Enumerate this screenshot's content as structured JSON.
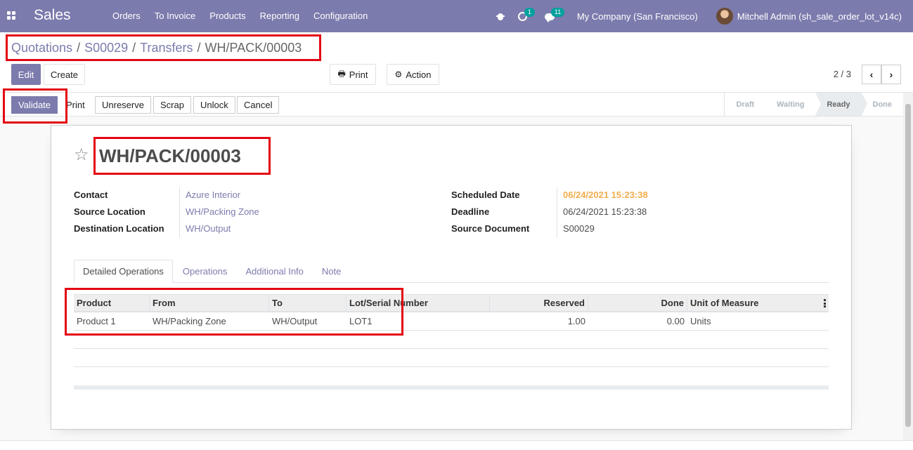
{
  "navbar": {
    "app_title": "Sales",
    "menu": [
      "Orders",
      "To Invoice",
      "Products",
      "Reporting",
      "Configuration"
    ],
    "activity_count": "1",
    "message_count": "11",
    "company": "My Company (San Francisco)",
    "user": "Mitchell Admin (sh_sale_order_lot_v14c)"
  },
  "breadcrumb": {
    "items": [
      "Quotations",
      "S00029",
      "Transfers"
    ],
    "current": "WH/PACK/00003"
  },
  "control": {
    "edit": "Edit",
    "create": "Create",
    "print": "Print",
    "action": "Action",
    "pager": "2 / 3"
  },
  "statusbar": {
    "buttons": [
      "Validate",
      "Print",
      "Unreserve",
      "Scrap",
      "Unlock",
      "Cancel"
    ],
    "stages": [
      "Draft",
      "Waiting",
      "Ready",
      "Done"
    ],
    "current_stage": "Ready"
  },
  "record": {
    "title": "WH/PACK/00003",
    "left_fields": [
      {
        "label": "Contact",
        "value": "Azure Interior"
      },
      {
        "label": "Source Location",
        "value": "WH/Packing Zone"
      },
      {
        "label": "Destination Location",
        "value": "WH/Output"
      }
    ],
    "right_fields": [
      {
        "label": "Scheduled Date",
        "value": "06/24/2021 15:23:38"
      },
      {
        "label": "Deadline",
        "value": "06/24/2021 15:23:38"
      },
      {
        "label": "Source Document",
        "value": "S00029"
      }
    ]
  },
  "tabs": [
    "Detailed Operations",
    "Operations",
    "Additional Info",
    "Note"
  ],
  "table": {
    "headers": [
      "Product",
      "From",
      "To",
      "Lot/Serial Number",
      "Reserved",
      "Done",
      "Unit of Measure"
    ],
    "rows": [
      [
        "Product 1",
        "WH/Packing Zone",
        "WH/Output",
        "LOT1",
        "1.00",
        "0.00",
        "Units"
      ]
    ]
  },
  "colors": {
    "brand": "#7c7bad",
    "highlight": "#e30613",
    "warning": "#f0ad4e",
    "badge": "#00a09d"
  }
}
